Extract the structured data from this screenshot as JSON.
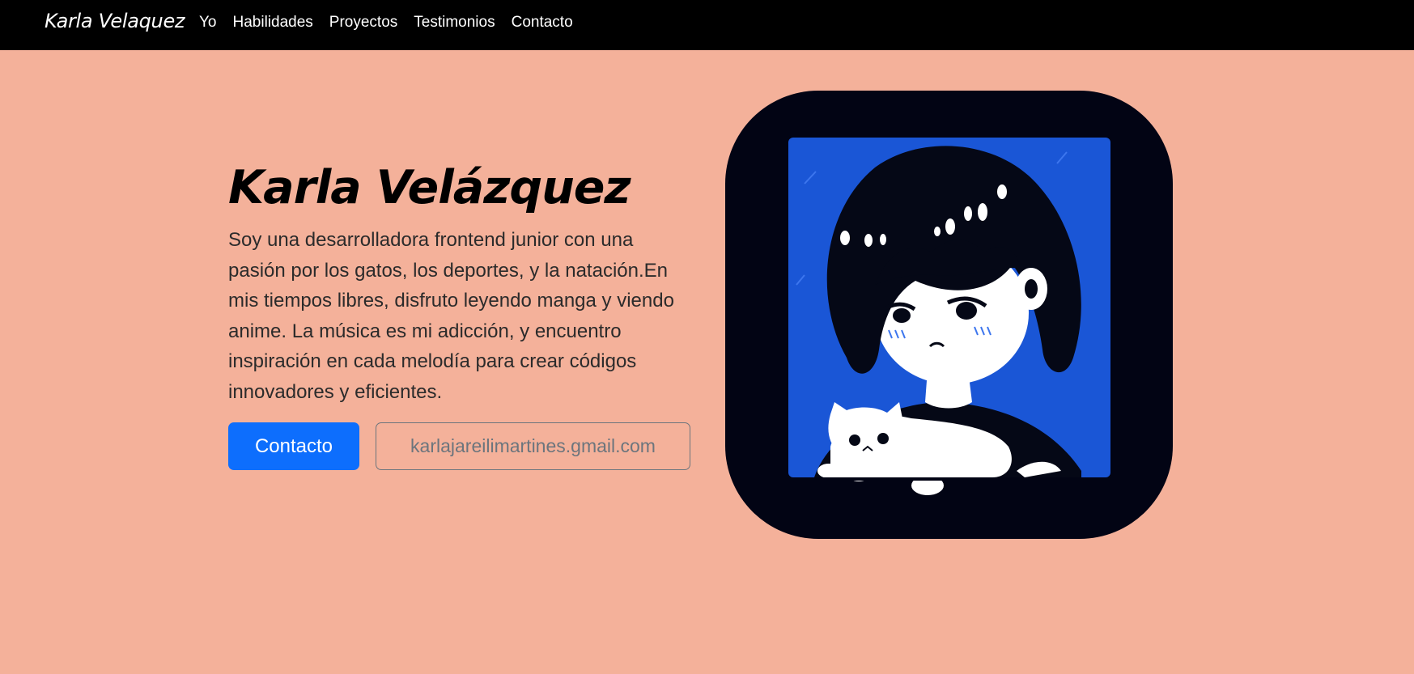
{
  "nav": {
    "brand": "Karla Velaquez",
    "links": [
      {
        "label": "Yo"
      },
      {
        "label": "Habilidades"
      },
      {
        "label": "Proyectos"
      },
      {
        "label": "Testimonios"
      },
      {
        "label": "Contacto"
      }
    ]
  },
  "hero": {
    "title": "Karla Velázquez",
    "description": "Soy una desarrolladora frontend junior con una pasión por los gatos, los deportes, y la natación.En mis tiempos libres, disfruto leyendo manga y viendo anime. La música es mi adicción, y encuentro inspiración en cada melodía para crear códigos innovadores y eficientes.",
    "contact_button": "Contacto",
    "email_button": "karlajareilimartines.gmail.com",
    "image_name": "anime-girl-with-cat-illustration"
  },
  "colors": {
    "background": "#f4b19a",
    "navbar": "#000000",
    "primary": "#0d6efd",
    "portrait_bg": "#020414",
    "portrait_blue": "#1a56d6"
  }
}
